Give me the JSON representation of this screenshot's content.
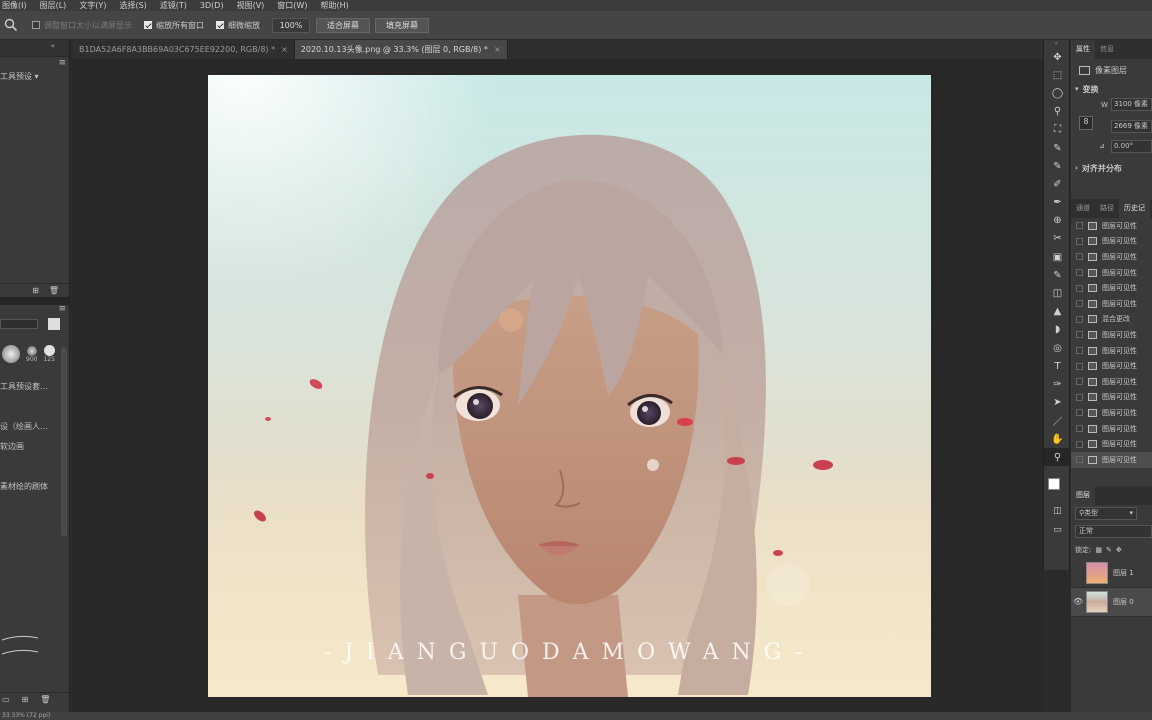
{
  "menu": [
    "图像(I)",
    "图层(L)",
    "文字(Y)",
    "选择(S)",
    "滤镜(T)",
    "3D(D)",
    "视图(V)",
    "窗口(W)",
    "帮助(H)"
  ],
  "options": {
    "resize_windows": "调整窗口大小以满屏显示",
    "zoom_all": "缩放所有窗口",
    "scrubby_zoom": "细微缩放",
    "zoom_value": "100%",
    "fit_screen": "适合屏幕",
    "fill_screen": "填充屏幕"
  },
  "tabs": {
    "tab1": "B1DA52A6F8A3BB69A03C675EE92200, RGB/8) *",
    "tab2": "2020.10.13头像.png @ 33.3% (图层 0, RGB/8) *"
  },
  "left_panel": {
    "tool_presets": "工具预设",
    "items": [
      "工具预设套...",
      "设（绘画人...",
      "软边画",
      "",
      "素材绘的刷体"
    ],
    "brush_sizes": [
      "900",
      "125"
    ]
  },
  "artwork": {
    "watermark": "-JIANGUODAMOWANG-"
  },
  "tools": [
    "✥",
    "⬚",
    "◯",
    "⚲",
    "⛶",
    "✎",
    "✎",
    "✐",
    "✒",
    "⊕",
    "✂",
    "▣",
    "✎",
    "◫",
    "▲",
    "◗",
    "◎",
    "T",
    "✑",
    "➤",
    "／",
    "✋",
    "⚲"
  ],
  "properties": {
    "tab_props": "属性",
    "tab_info": "信息",
    "layer_type": "像素图层",
    "transform": "变换",
    "w_label": "W",
    "w_value": "3100 像素",
    "h_value": "2669 像素",
    "angle": "0.00°",
    "align": "对齐并分布"
  },
  "history": {
    "tabs": [
      "通道",
      "路径",
      "历史记"
    ],
    "items": [
      "图层可见性",
      "图层可见性",
      "图层可见性",
      "图层可见性",
      "图层可见性",
      "图层可见性",
      "混合更改",
      "图层可见性",
      "图层可见性",
      "图层可见性",
      "图层可见性",
      "图层可见性",
      "图层可见性",
      "图层可见性",
      "图层可见性",
      "图层可见性"
    ]
  },
  "layers": {
    "tab": "图层",
    "filter": "类型",
    "blend": "正常",
    "lock": "锁定:",
    "rows": [
      {
        "name": "图层 1"
      },
      {
        "name": "图层 0"
      }
    ]
  },
  "status": "33.33% (72 ppi)"
}
